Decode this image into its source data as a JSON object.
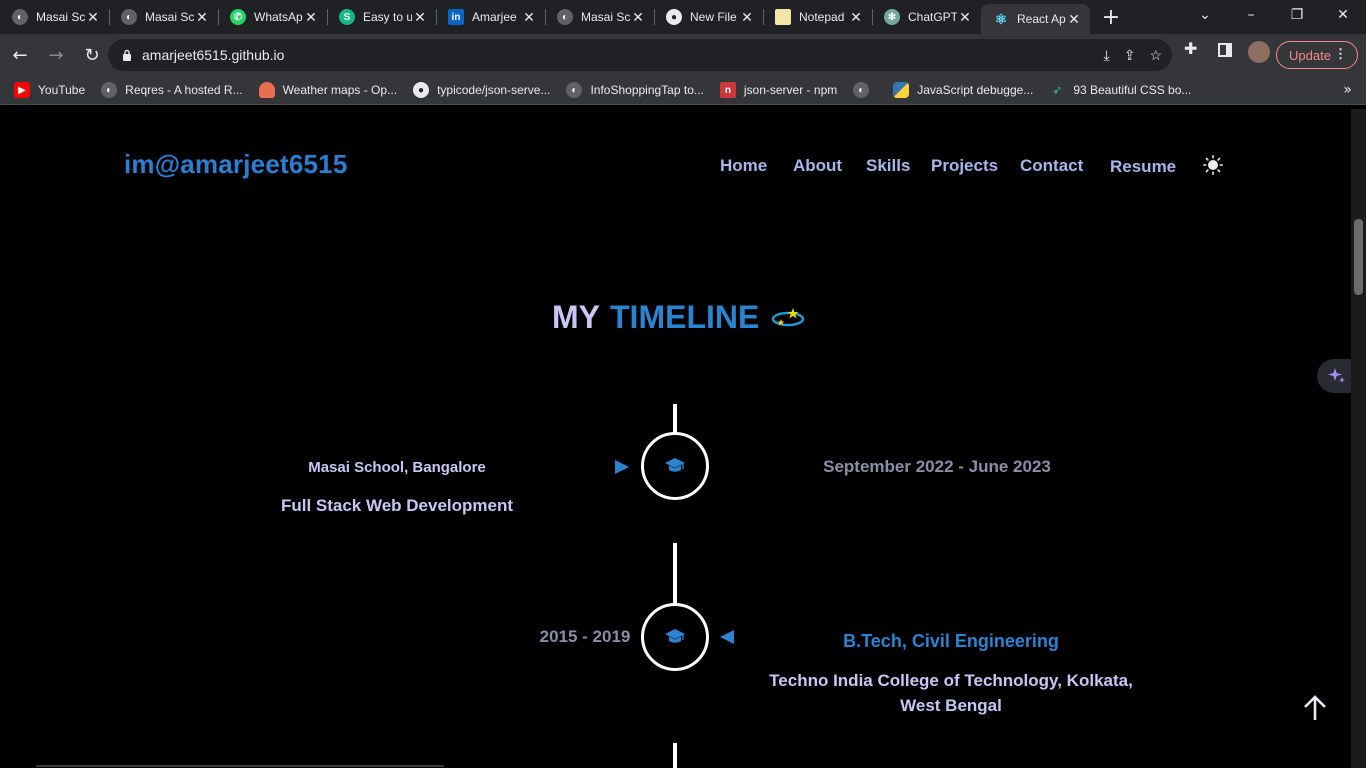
{
  "browser": {
    "tabs": [
      {
        "title": "Masai Sc",
        "icon": "globe-icon",
        "color": "#5f6368"
      },
      {
        "title": "Masai Sc",
        "icon": "globe-icon",
        "color": "#5f6368"
      },
      {
        "title": "WhatsAp",
        "icon": "whatsapp-icon",
        "color": "#25d366"
      },
      {
        "title": "Easy to u",
        "icon": "s-icon",
        "color": "#12b886"
      },
      {
        "title": "Amarjee",
        "icon": "linkedin-icon",
        "color": "#0a66c2"
      },
      {
        "title": "Masai Sc",
        "icon": "globe-icon",
        "color": "#5f6368"
      },
      {
        "title": "New File",
        "icon": "github-icon",
        "color": "#e8eaed"
      },
      {
        "title": "Notepad",
        "icon": "notepad-icon",
        "color": "#f4e6a8"
      },
      {
        "title": "ChatGPT",
        "icon": "chatgpt-icon",
        "color": "#74aa9c"
      },
      {
        "title": "React Ap",
        "icon": "react-icon",
        "color": "#61dafb"
      }
    ],
    "active_tab_index": 9,
    "url": "amarjeet6515.github.io",
    "update_label": "Update",
    "bookmarks": [
      {
        "label": "YouTube",
        "icon": "youtube-icon",
        "color": "#ff0000"
      },
      {
        "label": "Reqres - A hosted R...",
        "icon": "globe-icon",
        "color": "#5f6368"
      },
      {
        "label": "Weather maps - Op...",
        "icon": "weather-icon",
        "color": "#e96e50"
      },
      {
        "label": "typicode/json-serve...",
        "icon": "github-icon",
        "color": "#e8eaed"
      },
      {
        "label": "InfoShoppingTap to...",
        "icon": "globe-icon",
        "color": "#5f6368"
      },
      {
        "label": "json-server - npm",
        "icon": "npm-icon",
        "color": "#cb3837"
      },
      {
        "label": "",
        "icon": "globe-icon",
        "color": "#5f6368"
      },
      {
        "label": "JavaScript debugge...",
        "icon": "python-icon",
        "color": "#3776ab"
      },
      {
        "label": "93 Beautiful CSS bo...",
        "icon": "bird-icon",
        "color": "#2ecc71"
      }
    ]
  },
  "site": {
    "brand": "im@amarjeet6515",
    "nav": [
      "Home",
      "About",
      "Skills",
      "Projects",
      "Contact",
      "Resume"
    ],
    "heading_my": "MY",
    "heading_timeline": "TIMELINE",
    "timeline": [
      {
        "institution": "Masai School, Bangalore",
        "course": "Full Stack Web Development",
        "date": "September 2022 - June 2023",
        "icon": "graduation-cap-icon"
      },
      {
        "degree": "B.Tech, Civil Engineering",
        "college": "Techno India College of Technology, Kolkata, West Bengal",
        "date": "2015 - 2019",
        "icon": "graduation-cap-icon"
      }
    ]
  }
}
